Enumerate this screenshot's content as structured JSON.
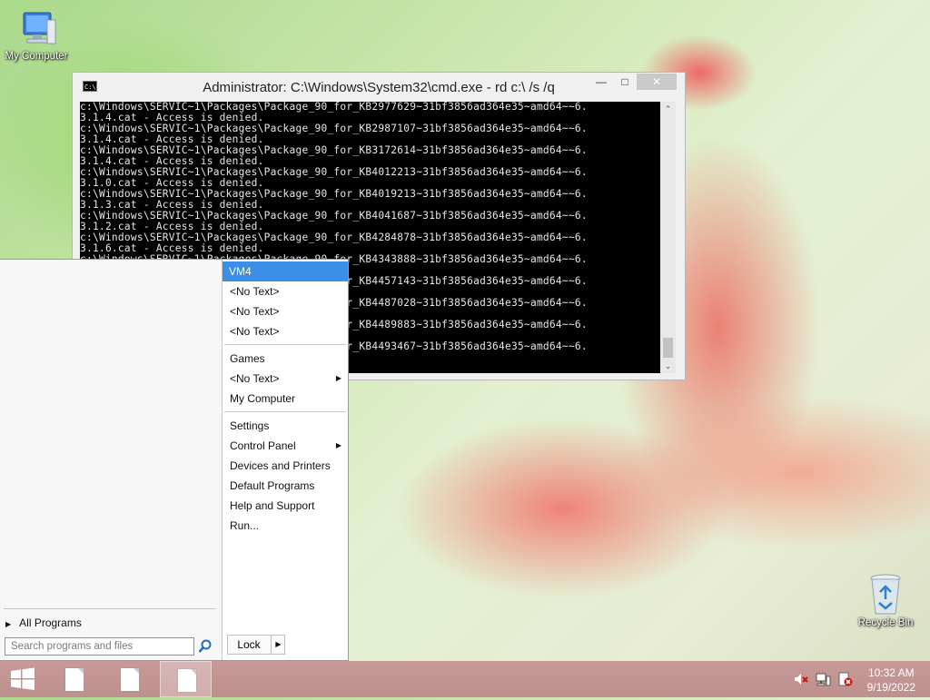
{
  "desktop": {
    "my_computer_label": "My Computer",
    "recycle_bin_label": "Recycle Bin"
  },
  "cmd": {
    "title": "Administrator: C:\\Windows\\System32\\cmd.exe - rd  c:\\ /s /q",
    "icon_text": "C:\\",
    "lines": [
      "c:\\Windows\\SERVIC~1\\Packages\\Package_90_for_KB2977629~31bf3856ad364e35~amd64~~6.",
      "3.1.4.cat - Access is denied.",
      "c:\\Windows\\SERVIC~1\\Packages\\Package_90_for_KB2987107~31bf3856ad364e35~amd64~~6.",
      "3.1.4.cat - Access is denied.",
      "c:\\Windows\\SERVIC~1\\Packages\\Package_90_for_KB3172614~31bf3856ad364e35~amd64~~6.",
      "3.1.4.cat - Access is denied.",
      "c:\\Windows\\SERVIC~1\\Packages\\Package_90_for_KB4012213~31bf3856ad364e35~amd64~~6.",
      "3.1.0.cat - Access is denied.",
      "c:\\Windows\\SERVIC~1\\Packages\\Package_90_for_KB4019213~31bf3856ad364e35~amd64~~6.",
      "3.1.3.cat - Access is denied.",
      "c:\\Windows\\SERVIC~1\\Packages\\Package_90_for_KB4041687~31bf3856ad364e35~amd64~~6.",
      "3.1.2.cat - Access is denied.",
      "c:\\Windows\\SERVIC~1\\Packages\\Package_90_for_KB4284878~31bf3856ad364e35~amd64~~6.",
      "3.1.6.cat - Access is denied.",
      "c:\\Windows\\SERVIC~1\\Packages\\Package_90_for_KB4343888~31bf3856ad364e35~amd64~~6.",
      "",
      "c:\\Windows\\SERVIC~1\\Packages\\Package_90_for_KB4457143~31bf3856ad364e35~amd64~~6.",
      "",
      "c:\\Windows\\SERVIC~1\\Packages\\Package_90_for_KB4487028~31bf3856ad364e35~amd64~~6.",
      "",
      "c:\\Windows\\SERVIC~1\\Packages\\Package_90_for_KB4489883~31bf3856ad364e35~amd64~~6.",
      "",
      "c:\\Windows\\SERVIC~1\\Packages\\Package_90_for_KB4493467~31bf3856ad364e35~amd64~~6."
    ]
  },
  "start_menu": {
    "right_items": [
      {
        "label": "VM4",
        "selected": true,
        "arrow": false
      },
      {
        "label": "<No Text>",
        "selected": false,
        "arrow": false
      },
      {
        "label": "<No Text>",
        "selected": false,
        "arrow": false
      },
      {
        "label": "<No Text>",
        "selected": false,
        "arrow": false
      },
      {
        "label": "Games",
        "selected": false,
        "arrow": false
      },
      {
        "label": "<No Text>",
        "selected": false,
        "arrow": true
      },
      {
        "label": "My Computer",
        "selected": false,
        "arrow": false
      },
      {
        "label": "Settings",
        "selected": false,
        "arrow": false
      },
      {
        "label": "Control Panel",
        "selected": false,
        "arrow": true
      },
      {
        "label": "Devices and Printers",
        "selected": false,
        "arrow": false
      },
      {
        "label": "Default Programs",
        "selected": false,
        "arrow": false
      },
      {
        "label": "Help and Support",
        "selected": false,
        "arrow": false
      },
      {
        "label": "Run...",
        "selected": false,
        "arrow": false
      }
    ],
    "all_programs": "All Programs",
    "search_placeholder": "Search programs and files",
    "lock_label": "Lock"
  },
  "taskbar": {
    "time": "10:32 AM",
    "date": "9/19/2022"
  },
  "colors": {
    "selection": "#3d8ee6",
    "taskbar": "#c39593",
    "console_bg": "#000000"
  }
}
